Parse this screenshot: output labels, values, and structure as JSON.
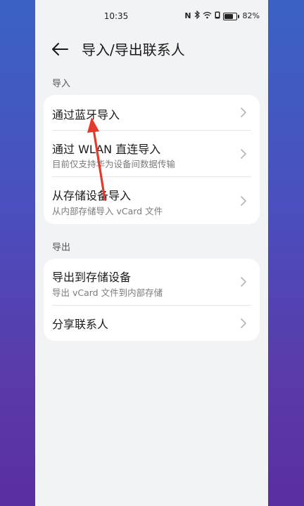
{
  "status_bar": {
    "time": "10:35",
    "nfc": "N",
    "battery_percent": "82%",
    "battery_level": 0.82
  },
  "header": {
    "title": "导入/导出联系人"
  },
  "import_section": {
    "label": "导入",
    "items": [
      {
        "title": "通过蓝牙导入",
        "subtitle": ""
      },
      {
        "title": "通过 WLAN 直连导入",
        "subtitle": "目前仅支持华为设备间数据传输"
      },
      {
        "title": "从存储设备导入",
        "subtitle": "从内部存储导入 vCard 文件"
      }
    ]
  },
  "export_section": {
    "label": "导出",
    "items": [
      {
        "title": "导出到存储设备",
        "subtitle": "导出 vCard 文件到内部存储"
      },
      {
        "title": "分享联系人",
        "subtitle": ""
      }
    ]
  },
  "colors": {
    "annotation_arrow": "#e23a2e",
    "page_background": "#f1f3f5"
  }
}
